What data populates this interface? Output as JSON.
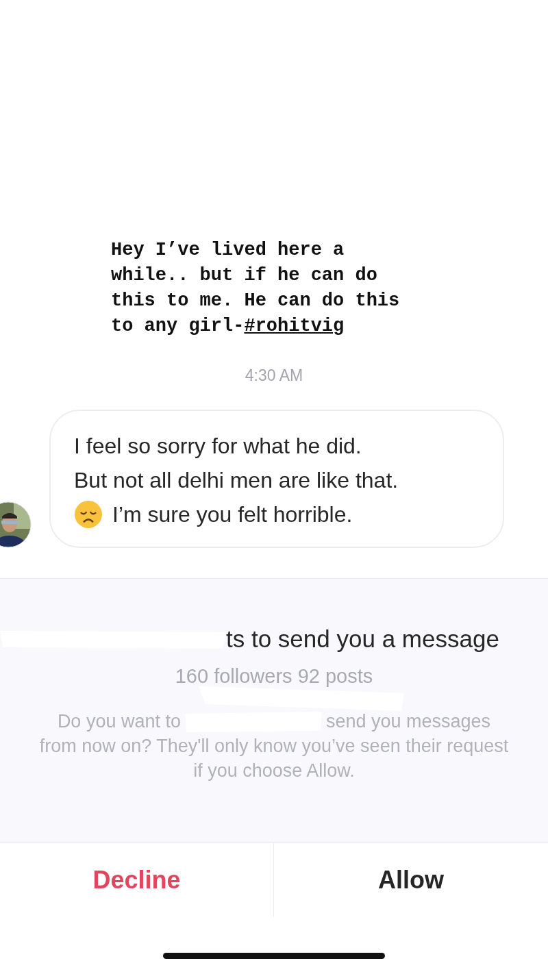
{
  "story": {
    "lines": [
      "Hey I’ve lived here a",
      "while..  but if he can do",
      "this to me. He can do this",
      "to any girl-"
    ],
    "hashtag": "#rohitvig"
  },
  "timestamp": "4:30 AM",
  "message": {
    "lines": [
      "I feel so sorry for what he did.",
      "But not all delhi men are like that."
    ],
    "last_line": "I’m sure you felt horrible."
  },
  "request": {
    "title": "ts to send you a message",
    "stats": "160 followers 92 posts",
    "prompt_start": "Do you want to",
    "prompt_end": "send you messages",
    "prompt_rest": "from now on? They'll only know you’ve seen their request if you choose Allow."
  },
  "buttons": [
    {
      "label": "Decline",
      "kind": "destructive"
    },
    {
      "label": "Allow",
      "kind": "default"
    }
  ]
}
